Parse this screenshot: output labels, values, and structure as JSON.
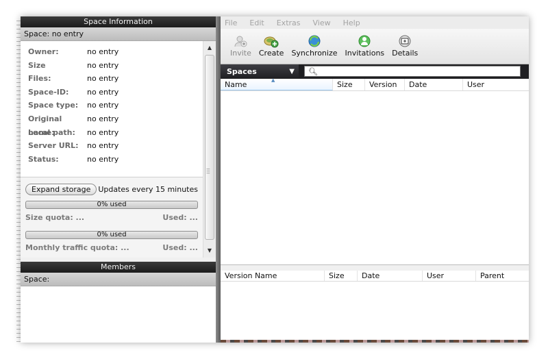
{
  "space_info": {
    "header": "Space Information",
    "space_label": "Space:",
    "space_value": "no entry",
    "fields": [
      {
        "label": "Owner:",
        "value": "no entry"
      },
      {
        "label": "Size",
        "value": "no entry"
      },
      {
        "label": "Files:",
        "value": "no entry"
      },
      {
        "label": "Space-ID:",
        "value": "no entry"
      },
      {
        "label": "Space type:",
        "value": "no entry"
      },
      {
        "label": "Original name:",
        "value": "no entry"
      },
      {
        "label": "Local path:",
        "value": "no entry"
      },
      {
        "label": "Server URL:",
        "value": "no entry"
      },
      {
        "label": "Status:",
        "value": "no entry"
      }
    ],
    "expand_storage": "Expand storage",
    "updates_text": "Updates every 15 minutes",
    "size_bar": {
      "text": "0% used",
      "percent": 0
    },
    "size_quota_label": "Size quota: ...",
    "size_used_label": "Used: ...",
    "traffic_bar": {
      "text": "0% used",
      "percent": 0
    },
    "traffic_quota_label": "Monthly traffic quota: ...",
    "traffic_used_label": "Used: ..."
  },
  "members": {
    "header": "Members",
    "space_label": "Space:"
  },
  "menu": [
    "File",
    "Edit",
    "Extras",
    "View",
    "Help"
  ],
  "toolbar": [
    {
      "label": "Invite",
      "icon": "invite-icon",
      "disabled": true
    },
    {
      "label": "Create",
      "icon": "create-icon",
      "disabled": false
    },
    {
      "label": "Synchronize",
      "icon": "synchronize-icon",
      "disabled": false
    },
    {
      "label": "Invitations",
      "icon": "invitations-icon",
      "disabled": false
    },
    {
      "label": "Details",
      "icon": "details-icon",
      "disabled": false
    }
  ],
  "spaces_bar": {
    "label": "Spaces",
    "search_placeholder": ""
  },
  "spaces_table": {
    "columns": [
      "Name",
      "Size",
      "Version",
      "Date",
      "User"
    ],
    "rows": []
  },
  "versions_table": {
    "columns": [
      "Version Name",
      "Size",
      "Date",
      "User",
      "Parent"
    ],
    "rows": []
  },
  "colors": {
    "header_dark": "#1f1f22",
    "splitter": "#6a6a6a",
    "sorted_header": "#eaf4ff"
  }
}
